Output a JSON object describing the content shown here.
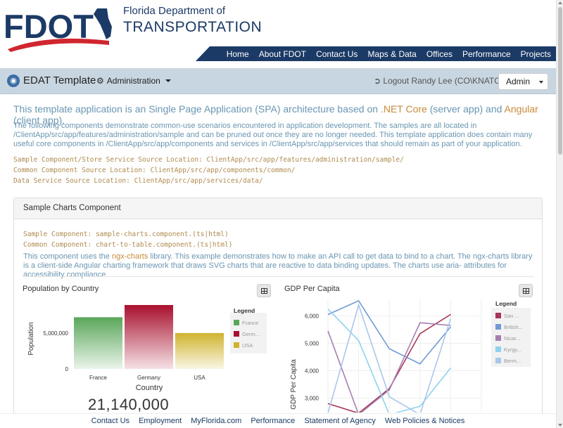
{
  "colors": {
    "navy": "#1b3a66",
    "red": "#d0262f",
    "link_blue": "#6a96b3",
    "highlight": "#c98a3a",
    "appbar_bg": "#c7d6e0"
  },
  "header": {
    "logo_text": "FDOT",
    "agency_small": "Florida Department of",
    "agency_large": "TRANSPORTATION",
    "nav": [
      "Home",
      "About FDOT",
      "Contact Us",
      "Maps & Data",
      "Offices",
      "Performance",
      "Projects"
    ]
  },
  "appbar": {
    "icon": "app-globe-icon",
    "title": "EDAT Template",
    "admin_icon": "cogs-icon",
    "admin_label": "Administration",
    "logout_icon": "sign-out-icon",
    "logout_label": "Logout Randy Lee (CO\\KNATCRL)",
    "role_selected": "Admin"
  },
  "intro": {
    "lead_a": "This template application is an Single Page Application (SPA) architecture based on ",
    "lead_hl1": ".NET Core",
    "lead_b": " (server app) and ",
    "lead_hl2": "Angular",
    "lead_c": " (client app).",
    "body": "The following components demonstrate common-use scenarios encountered in application development. The samples are all located in /ClientApp/src/app/features/administration/sample and can be pruned out once they are no longer needed. This template application does contain many useful core components in /ClientApp/src/app/components and services in /ClientApp/src/app/services that should remain as part of your application.",
    "code_lines": [
      "Sample Component/Store Service Source Location: ClientApp/src/app/features/administration/sample/",
      "Common Component Source Location: ClientApp/src/app/components/common/",
      "Data Service Source Location: ClientApp/src/app/services/data/"
    ]
  },
  "card": {
    "title": "Sample Charts Component",
    "code_lines": [
      "Sample Component: sample-charts.component.(ts|html)",
      "Common Component: chart-to-table.component.(ts|html)"
    ],
    "desc_a": "This component uses the ",
    "desc_hl": "ngx-charts",
    "desc_b": " library. This example demonstrates how to make an API call to get data to bind to a chart. The ngx-charts library is a client-side Angular charting framework that draws SVG charts that are reactive to data binding updates. The charts use aria- attributes for accessibility compliance.",
    "big_number": "21,140,000"
  },
  "chart_data": [
    {
      "type": "bar",
      "title": "Population by Country",
      "xlabel": "Country",
      "ylabel": "Population",
      "categories": [
        "France",
        "Germany",
        "USA"
      ],
      "values": [
        7200000,
        8900000,
        5000000
      ],
      "ylim": [
        0,
        9000000
      ],
      "yticks": [
        {
          "v": 0,
          "label": "0"
        },
        {
          "v": 5000000,
          "label": "5,000,000"
        }
      ],
      "colors": [
        "#5aa65a",
        "#a8102e",
        "#cfb32e"
      ],
      "legend_title": "Legend",
      "legend": [
        "France",
        "Germ...",
        "USA"
      ],
      "grid": false,
      "legend_position": "right"
    },
    {
      "type": "line",
      "title": "GDP Per Capita",
      "ylabel": "GDP Per Capita",
      "ylim": [
        2500,
        6600
      ],
      "yticks": [
        3000,
        4000,
        5000,
        6000
      ],
      "ytick_labels": [
        "3,000",
        "4,000",
        "5,000",
        "6,000"
      ],
      "x": [
        0,
        1,
        2,
        3,
        4,
        5
      ],
      "legend_title": "Legend",
      "grid": true,
      "legend_position": "right",
      "series": [
        {
          "name": "San ...",
          "color": "#a8365a",
          "values": [
            2800,
            2450,
            3350,
            5350,
            6050,
            null
          ]
        },
        {
          "name": "British...",
          "color": "#6f9ad6",
          "values": [
            6050,
            6550,
            4800,
            4250,
            5600,
            null
          ]
        },
        {
          "name": "Nicar...",
          "color": "#a57fb0",
          "values": [
            5450,
            2400,
            3300,
            5750,
            5650,
            null
          ]
        },
        {
          "name": "Kyrgy...",
          "color": "#8fd3ef",
          "values": [
            6250,
            5100,
            2400,
            2700,
            4100,
            null
          ]
        },
        {
          "name": "Berm...",
          "color": "#a9c7ec",
          "values": [
            2450,
            6400,
            3050,
            2400,
            5900,
            null
          ]
        }
      ]
    }
  ],
  "footer": [
    "Contact Us",
    "Employment",
    "MyFlorida.com",
    "Performance",
    "Statement of Agency",
    "Web Policies & Notices"
  ]
}
